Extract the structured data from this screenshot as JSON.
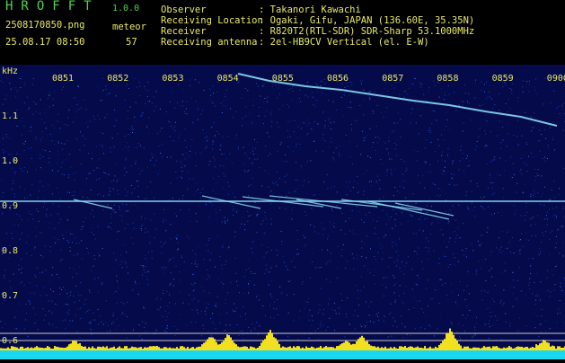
{
  "header": {
    "app_title": "HROFFT",
    "app_version": "1.0.0",
    "file_name": "2508170850.png",
    "timestamp": "25.08.17 08:50",
    "meteor_label": "meteor",
    "meteor_count": "57",
    "info": [
      {
        "label": "Observer",
        "value": ": Takanori Kawachi"
      },
      {
        "label": "Receiving Location",
        "value": ": Ogaki, Gifu, JAPAN (136.60E, 35.35N)"
      },
      {
        "label": "Receiver",
        "value": ": R820T2(RTL-SDR) SDR-Sharp 53.1000MHz"
      },
      {
        "label": "Receiving antenna",
        "value": ": 2el-HB9CV Vertical (el. E-W)"
      }
    ]
  },
  "spectrogram": {
    "unit_label": "kHz",
    "time_ticks": [
      "0851",
      "0852",
      "0853",
      "0854",
      "0855",
      "0856",
      "0857",
      "0858",
      "0859",
      "0900"
    ],
    "freq_ticks": [
      "1.1",
      "1.0",
      "0.9",
      "0.8",
      "0.7",
      "0.6"
    ],
    "colors": {
      "background": "#050a4a",
      "trace": "#8fe8ff",
      "label": "#e8e86a",
      "activity": "#f0e020",
      "base": "#18d8f0"
    }
  }
}
